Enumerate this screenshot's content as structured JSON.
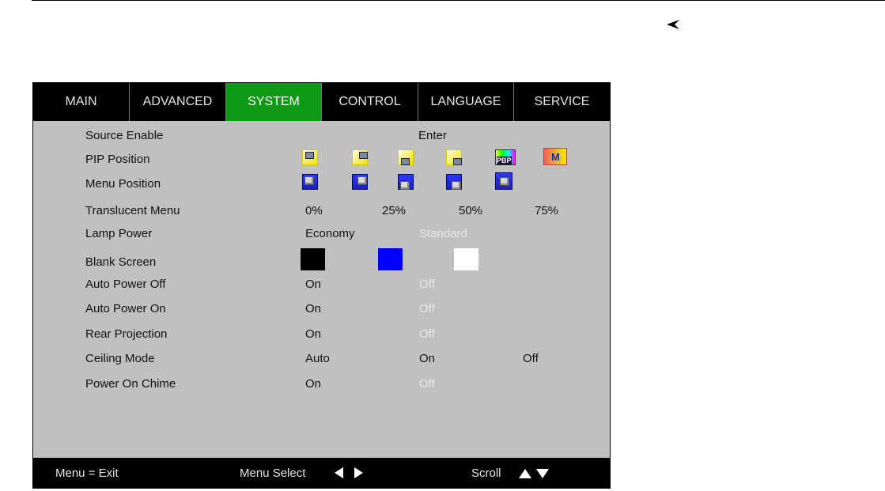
{
  "tabs": [
    {
      "label": "MAIN",
      "active": false
    },
    {
      "label": "ADVANCED",
      "active": false
    },
    {
      "label": "SYSTEM",
      "active": true
    },
    {
      "label": "CONTROL",
      "active": false
    },
    {
      "label": "LANGUAGE",
      "active": false
    },
    {
      "label": "SERVICE",
      "active": false
    }
  ],
  "settings": {
    "source_enable": {
      "label": "Source Enable",
      "options": [
        "Enter"
      ]
    },
    "pip_position": {
      "label": "PIP Position",
      "icons": [
        "pip-top-left-icon",
        "pip-top-right-icon",
        "pip-bottom-left-icon",
        "pip-bottom-right-icon",
        "pip-pbp-icon",
        "pip-off-icon"
      ],
      "pbp_text": "PBP",
      "off_text": "M"
    },
    "menu_position": {
      "label": "Menu Position",
      "icons": [
        "menu-top-left-icon",
        "menu-top-right-icon",
        "menu-bottom-left-icon",
        "menu-bottom-right-icon",
        "menu-center-icon"
      ]
    },
    "translucent_menu": {
      "label": "Translucent Menu",
      "options": [
        "0%",
        "25%",
        "50%",
        "75%"
      ]
    },
    "lamp_power": {
      "label": "Lamp Power",
      "options": [
        "Economy",
        "Standard"
      ],
      "selected": "Standard"
    },
    "blank_screen": {
      "label": "Blank Screen",
      "colors": [
        "#000000",
        "#0000ff",
        "#ffffff"
      ]
    },
    "auto_power_off": {
      "label": "Auto Power Off",
      "options": [
        "On",
        "Off"
      ],
      "selected": "Off"
    },
    "auto_power_on": {
      "label": "Auto Power On",
      "options": [
        "On",
        "Off"
      ],
      "selected": "Off"
    },
    "rear_projection": {
      "label": "Rear Projection",
      "options": [
        "On",
        "Off"
      ],
      "selected": "Off"
    },
    "ceiling_mode": {
      "label": "Ceiling Mode",
      "options": [
        "Auto",
        "On",
        "Off"
      ]
    },
    "power_on_chime": {
      "label": "Power On Chime",
      "options": [
        "On",
        "Off"
      ],
      "selected": "Off"
    }
  },
  "footer": {
    "exit": "Menu = Exit",
    "select": "Menu Select",
    "scroll": "Scroll"
  },
  "colors": {
    "tab_active": "#0f9a16",
    "panel": "#c0c0c0",
    "bar": "#000000",
    "dim_text": "#e8e8e8"
  }
}
